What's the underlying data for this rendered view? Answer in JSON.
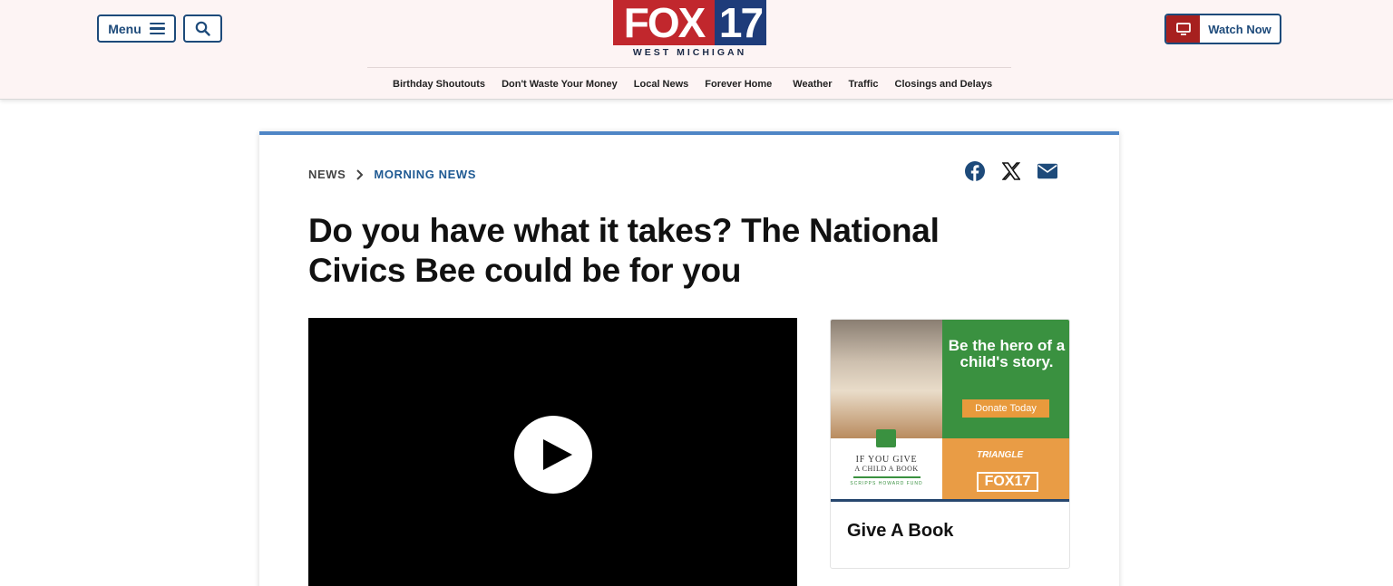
{
  "header": {
    "menu_label": "Menu",
    "logo": {
      "brand": "FOX",
      "number": "17",
      "tagline": "WEST MICHIGAN"
    },
    "watch_label": "Watch Now",
    "nav": [
      "Birthday Shoutouts",
      "Don't Waste Your Money",
      "Local News",
      "Forever Home",
      "Weather",
      "Traffic",
      "Closings and Delays"
    ]
  },
  "article": {
    "breadcrumb": {
      "section": "NEWS",
      "subsection": "MORNING NEWS"
    },
    "share_icons": [
      "facebook-icon",
      "x-icon",
      "email-icon"
    ],
    "headline": "Do you have what it takes? The National Civics Bee could be for you"
  },
  "video": {
    "state": "paused",
    "control_icon": "play-icon"
  },
  "promo": {
    "hero_text": "Be the hero of a child's story.",
    "donate_label": "Donate Today",
    "book_line1": "IF YOU GIVE",
    "book_line2": "A CHILD A BOOK",
    "book_line3": "SCRIPPS HOWARD FUND",
    "partner_name": "TRIANGLE",
    "partner_logo": "FOX17",
    "caption": "Give A Book"
  },
  "colors": {
    "header_bg": "#fdf4f4",
    "brand_blue": "#1d4a7a",
    "brand_red": "#c1272d",
    "card_accent": "#4f86c6",
    "promo_green": "#3a9140",
    "promo_orange": "#e99c45"
  }
}
